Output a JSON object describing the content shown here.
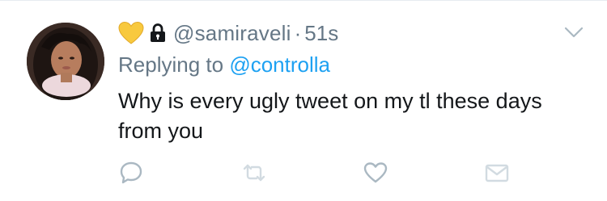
{
  "tweet": {
    "handle": "@samiraveli",
    "separator": "·",
    "time": "51s",
    "replying_prefix": "Replying to ",
    "replying_to": "@controlla",
    "text": "Why is every ugly tweet on my tl these days from you"
  },
  "icons": {
    "header_emoji": "yellow-heart-icon",
    "protected": "lock-icon",
    "menu": "chevron-down-icon",
    "reply": "reply-icon",
    "retweet": "retweet-icon",
    "like": "heart-icon",
    "dm": "envelope-icon"
  },
  "colors": {
    "muted": "#657786",
    "link": "#1da1f2",
    "text": "#14171a",
    "icon": "#aab8c2",
    "heart_emoji": "#f8c93e"
  }
}
